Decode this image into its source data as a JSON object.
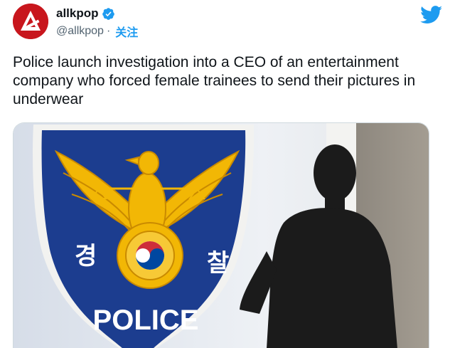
{
  "author": {
    "display_name": "allkpop",
    "handle": "@allkpop",
    "separator": "·",
    "follow_label": "关注",
    "verified": true,
    "avatar_icon": "allkpop-logo-icon",
    "avatar_color": "#c8161d"
  },
  "brand": {
    "icon": "twitter-bird-icon",
    "color": "#1d9bf0"
  },
  "tweet": {
    "text": "Police launch investigation into a CEO of an entertainment company who forced female trainees to send their pictures in underwear"
  },
  "media": {
    "badge_left_char": "경",
    "badge_right_char": "찰",
    "badge_label": "POLICE",
    "badge_color": "#1c3d8f",
    "emblem_color": "#f2b705"
  }
}
